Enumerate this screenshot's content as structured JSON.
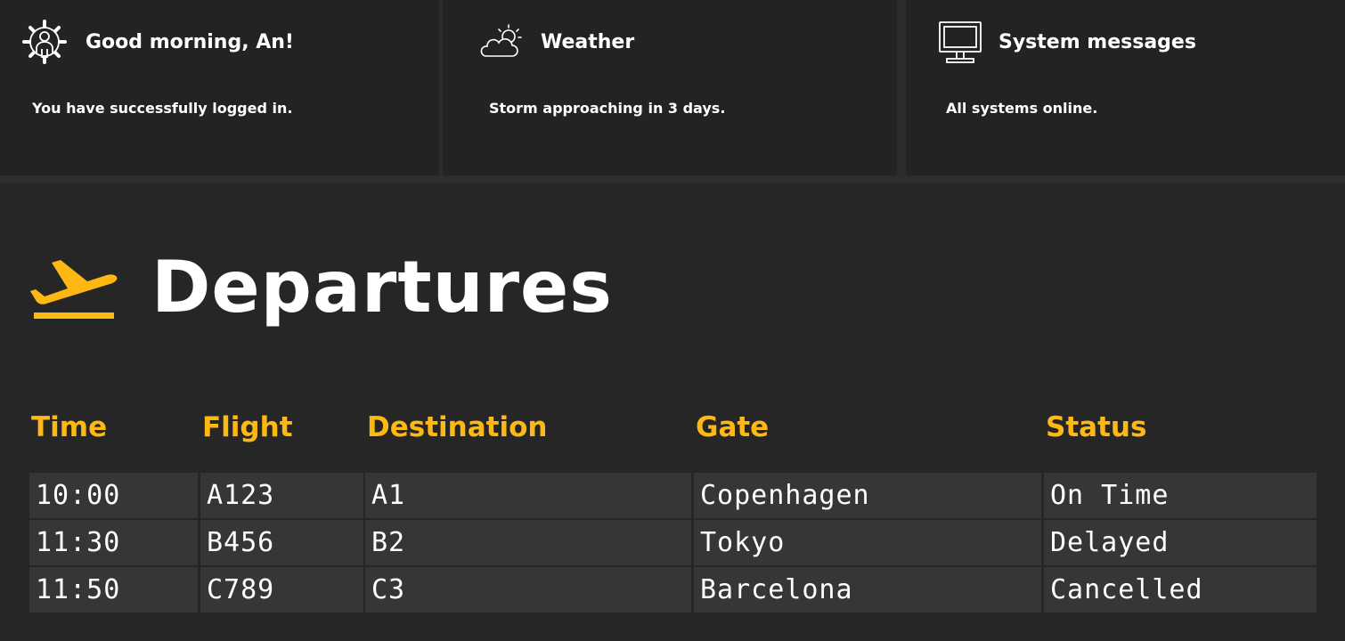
{
  "colors": {
    "background": "#262626",
    "card": "#232323",
    "accent": "#fdb813",
    "cell": "#363638",
    "text": "#ffffff"
  },
  "cards": [
    {
      "icon": "user-gear-icon",
      "title": "Good morning, An!",
      "body": "You have successfully logged in."
    },
    {
      "icon": "cloud-sun-icon",
      "title": "Weather",
      "body": "Storm approaching in 3 days."
    },
    {
      "icon": "monitor-icon",
      "title": "System messages",
      "body": "All systems online."
    }
  ],
  "departures": {
    "icon": "plane-departure-icon",
    "title": "Departures",
    "columns": [
      "Time",
      "Flight",
      "Destination",
      "Gate",
      "Status"
    ],
    "rows": [
      [
        "10:00",
        "A123",
        "A1",
        "Copenhagen",
        "On Time"
      ],
      [
        "11:30",
        "B456",
        "B2",
        "Tokyo",
        "Delayed"
      ],
      [
        "11:50",
        "C789",
        "C3",
        "Barcelona",
        "Cancelled"
      ]
    ]
  }
}
